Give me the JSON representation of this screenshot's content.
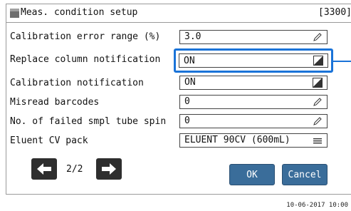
{
  "header": {
    "title": "Meas. condition setup",
    "screen_code": "[3300]"
  },
  "rows": [
    {
      "label": "Calibration error range (%)",
      "value": "3.0",
      "icon": "pencil-icon"
    },
    {
      "label": "Replace column notification",
      "value": "ON",
      "icon": "toggle-icon",
      "selected": true
    },
    {
      "label": "Calibration notification",
      "value": "ON",
      "icon": "toggle-icon"
    },
    {
      "label": "Misread barcodes",
      "value": "0",
      "icon": "pencil-icon"
    },
    {
      "label": "No. of failed smpl tube spin",
      "value": "0",
      "icon": "pencil-icon"
    },
    {
      "label": "Eluent CV pack",
      "value": "ELUENT 90CV (600mL)",
      "icon": "list-icon"
    }
  ],
  "pagination": {
    "indicator": "2/2"
  },
  "buttons": {
    "ok": "OK",
    "cancel": "Cancel"
  },
  "footer": {
    "timestamp": "10-06-2017 10:00"
  },
  "colors": {
    "selection_accent": "#1a73d8",
    "button_bg": "#3a6d9a",
    "nav_bg": "#2e2e2e"
  }
}
